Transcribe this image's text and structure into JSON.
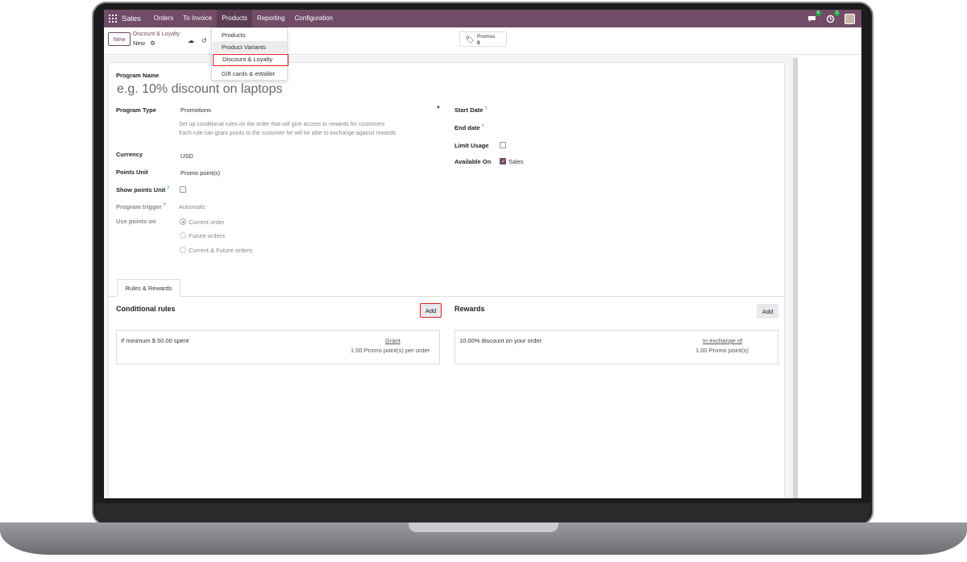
{
  "navbar": {
    "app_name": "Sales",
    "menu": [
      "Orders",
      "To Invoice",
      "Products",
      "Reporting",
      "Configuration"
    ],
    "active_menu": "Products",
    "messages_badge": "6",
    "activities_badge": "2",
    "brand_color": "#714b67"
  },
  "control_panel": {
    "new_label": "New",
    "breadcrumb_parent": "Discount & Loyalty",
    "breadcrumb_current": "New",
    "promos_label": "Promos",
    "promos_count": "0"
  },
  "products_dropdown": {
    "items": [
      "Products",
      "Product Variants",
      "Discount & Loyalty",
      "Gift cards & eWallet"
    ],
    "hovered": "Product Variants",
    "highlighted": "Discount & Loyalty"
  },
  "form": {
    "program_name_label": "Program Name",
    "program_name_placeholder": "e.g. 10% discount on laptops",
    "program_type_label": "Program Type",
    "program_type_value": "Promotions",
    "program_type_help_1": "Set up conditional rules on the order that will give access to rewards for customers",
    "program_type_help_2": "Each rule can grant points to the customer he will be able to exchange against rewards",
    "currency_label": "Currency",
    "currency_value": "USD",
    "points_unit_label": "Points Unit",
    "points_unit_value": "Promo point(s)",
    "show_points_unit_label": "Show points Unit",
    "program_trigger_label": "Program trigger",
    "program_trigger_value": "Automatic",
    "use_points_on_label": "Use points on",
    "use_points_options": [
      "Current order",
      "Future orders",
      "Current & Future orders"
    ],
    "use_points_selected": "Current order",
    "start_date_label": "Start Date",
    "end_date_label": "End date",
    "limit_usage_label": "Limit Usage",
    "available_on_label": "Available On",
    "available_on_sales": "Sales",
    "help_mark": "?"
  },
  "tabs": {
    "rules_rewards": "Rules & Rewards"
  },
  "conditional_rules": {
    "title": "Conditional rules",
    "add_label": "Add",
    "rule_text": "If minimum $ 50.00 spent",
    "rule_link": "Grant",
    "rule_sub": "1.00 Promo point(s) per order"
  },
  "rewards": {
    "title": "Rewards",
    "add_label": "Add",
    "reward_text": "10.00% discount on your order",
    "reward_link": "In exchange of",
    "reward_sub": "1.00 Promo point(s)"
  }
}
